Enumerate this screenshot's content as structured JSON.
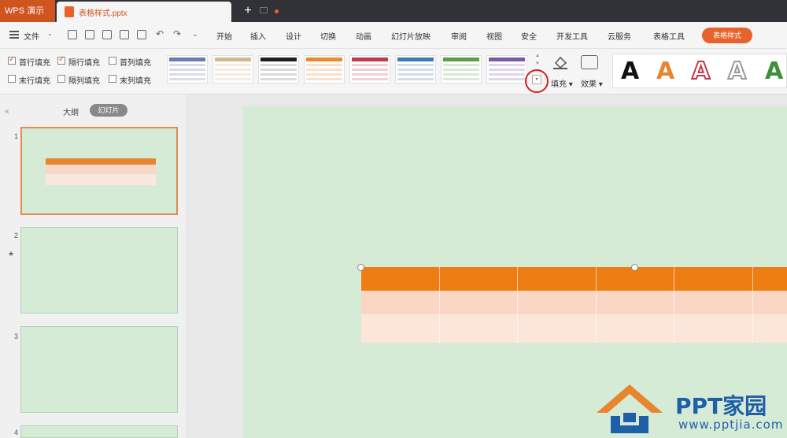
{
  "tabbar": {
    "app_name": "WPS 演示",
    "doc_title": "表格样式.pptx",
    "new_tab_label": "+"
  },
  "menubar": {
    "file_label": "文件",
    "file_caret": "⌄",
    "items": [
      "开始",
      "插入",
      "设计",
      "切换",
      "动画",
      "幻灯片放映",
      "审阅",
      "视图",
      "安全",
      "开发工具",
      "云服务",
      "表格工具"
    ],
    "cta_label": "表格样式"
  },
  "ribbon": {
    "checkboxes": [
      {
        "label": "首行填充",
        "checked": true
      },
      {
        "label": "隔行填充",
        "checked": true
      },
      {
        "label": "首列填充",
        "checked": false
      },
      {
        "label": "末行填充",
        "checked": false
      },
      {
        "label": "隔列填充",
        "checked": false
      },
      {
        "label": "末列填充",
        "checked": false
      }
    ],
    "table_styles": [
      {
        "header": "#6d7bb5",
        "row": "#b9c0dd"
      },
      {
        "header": "#d5b98c",
        "row": "#eadcc6"
      },
      {
        "header": "#1e1e1e",
        "row": "#bdbdbd"
      },
      {
        "header": "#ee8a2a",
        "row": "#f6c9a4"
      },
      {
        "header": "#c2394a",
        "row": "#e7aab2"
      },
      {
        "header": "#3f79b8",
        "row": "#aac5e3"
      },
      {
        "header": "#5c9d4e",
        "row": "#b9d9b1"
      },
      {
        "header": "#7a59a8",
        "row": "#c6b6de"
      }
    ],
    "scroll_up": "▲",
    "scroll_down": "▼",
    "more_label": "▾",
    "fill_label": "填充 ▾",
    "effect_label": "效果 ▾",
    "art_letters": [
      {
        "char": "A",
        "color": "#111111",
        "style": "solid"
      },
      {
        "char": "A",
        "color": "#e8862f",
        "style": "solid"
      },
      {
        "char": "A",
        "color": "#c2394a",
        "style": "outline"
      },
      {
        "char": "A",
        "color": "#999999",
        "style": "outline"
      },
      {
        "char": "A",
        "color": "#3f8f3a",
        "style": "solid"
      }
    ]
  },
  "left_panel": {
    "collapse_icon": "«",
    "tab_outline": "大纲",
    "tab_slides": "幻灯片",
    "slide_numbers": [
      "1",
      "2",
      "3",
      "4"
    ],
    "star_marker": "★"
  },
  "canvas": {
    "slide_background": "#d5ebd6",
    "table_header_color": "#ee7d13",
    "table_row1_color": "#f9d7c4",
    "table_row2_color": "#fce6da",
    "table_columns": 6
  },
  "watermark": {
    "brand": "PPT家园",
    "url": "www.pptjia.com"
  },
  "colors": {
    "accent": "#e8622c",
    "annotation_red": "#d42020"
  }
}
